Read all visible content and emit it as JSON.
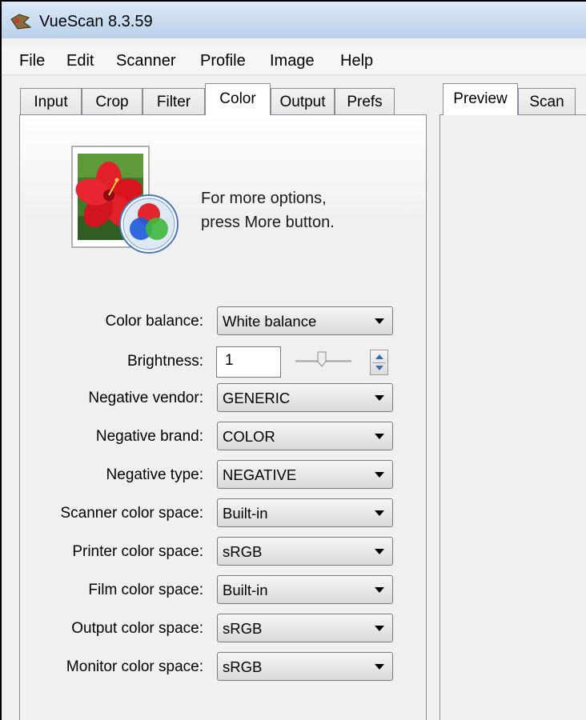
{
  "window": {
    "title": "VueScan 8.3.59",
    "app_icon": "vuescan-app-icon"
  },
  "menu": [
    "File",
    "Edit",
    "Scanner",
    "Profile",
    "Image",
    "Help"
  ],
  "left_tabs": [
    "Input",
    "Crop",
    "Filter",
    "Color",
    "Output",
    "Prefs"
  ],
  "left_active_tab": "Color",
  "right_tabs": [
    "Preview",
    "Scan"
  ],
  "right_active_tab": "Preview",
  "info": {
    "icon": "color-flower-icon",
    "text": "For more options,\npress More button."
  },
  "fields": {
    "color_balance": {
      "label": "Color balance:",
      "value": "White balance"
    },
    "brightness": {
      "label": "Brightness:",
      "value": "1"
    },
    "negative_vendor": {
      "label": "Negative vendor:",
      "value": "GENERIC"
    },
    "negative_brand": {
      "label": "Negative brand:",
      "value": "COLOR"
    },
    "negative_type": {
      "label": "Negative type:",
      "value": "NEGATIVE"
    },
    "scanner_color_space": {
      "label": "Scanner color space:",
      "value": "Built-in"
    },
    "printer_color_space": {
      "label": "Printer color space:",
      "value": "sRGB"
    },
    "film_color_space": {
      "label": "Film color space:",
      "value": "Built-in"
    },
    "output_color_space": {
      "label": "Output color space:",
      "value": "sRGB"
    },
    "monitor_color_space": {
      "label": "Monitor color space:",
      "value": "sRGB"
    }
  },
  "icons": {
    "slider": "brightness-slider-thumb",
    "spinner": "brightness-spinner-icon",
    "dropdown": "chevron-down-icon"
  }
}
